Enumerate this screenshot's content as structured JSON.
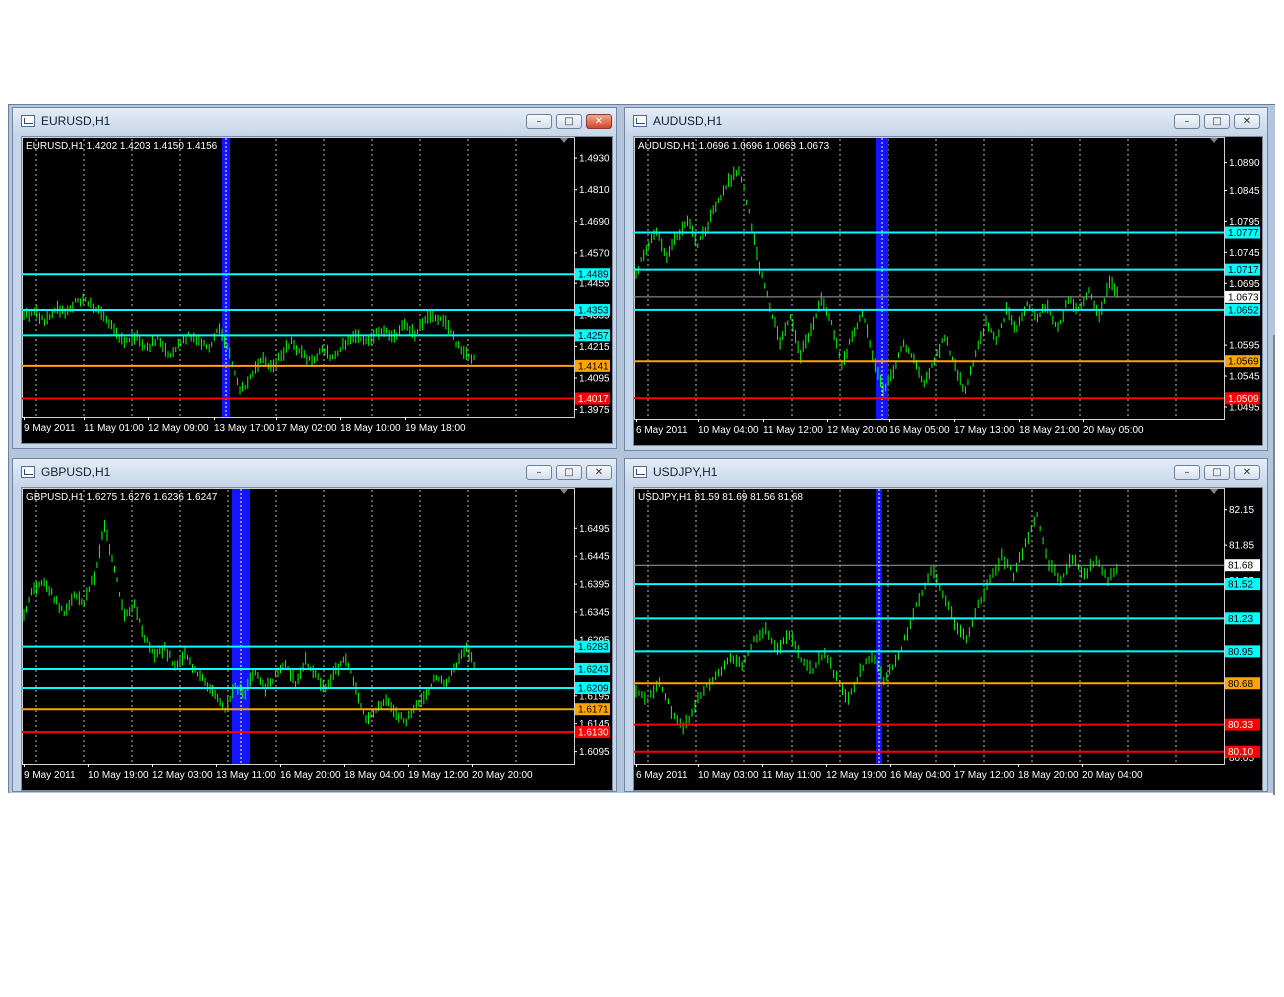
{
  "windows": [
    {
      "title": "EURUSD,H1",
      "info": "EURUSD,H1  1.4202 1.4203 1.4150 1.4156",
      "axis_labels": [
        {
          "text": "1.4930",
          "v": 1.493
        },
        {
          "text": "1.4810",
          "v": 1.481
        },
        {
          "text": "1.4690",
          "v": 1.469
        },
        {
          "text": "1.4570",
          "v": 1.457
        },
        {
          "text": "1.4455",
          "v": 1.4455
        },
        {
          "text": "1.4335",
          "v": 1.4335
        },
        {
          "text": "1.4215",
          "v": 1.4215
        },
        {
          "text": "1.4095",
          "v": 1.4095
        },
        {
          "text": "1.3975",
          "v": 1.3975
        }
      ],
      "levels": [
        {
          "text": "1.4489",
          "v": 1.4489,
          "color": "#00ffff"
        },
        {
          "text": "1.4353",
          "v": 1.4353,
          "color": "#00ffff"
        },
        {
          "text": "1.4257",
          "v": 1.4257,
          "color": "#00ffff"
        },
        {
          "text": "1.4141",
          "v": 1.4141,
          "color": "#ffa500"
        },
        {
          "text": "1.4017",
          "v": 1.4017,
          "color": "#ff0000"
        }
      ],
      "current": null,
      "time_labels": [
        "9 May 2011",
        "11 May 01:00",
        "12 May 09:00",
        "13 May 17:00",
        "17 May 02:00",
        "18 May 10:00",
        "19 May 18:00"
      ],
      "price_path": [
        1.433,
        1.435,
        1.431,
        1.436,
        1.434,
        1.438,
        1.439,
        1.436,
        1.432,
        1.426,
        1.423,
        1.425,
        1.421,
        1.424,
        1.418,
        1.422,
        1.426,
        1.424,
        1.421,
        1.429,
        1.418,
        1.404,
        1.409,
        1.417,
        1.414,
        1.418,
        1.423,
        1.419,
        1.415,
        1.42,
        1.417,
        1.422,
        1.426,
        1.423,
        1.426,
        1.428,
        1.425,
        1.43,
        1.426,
        1.432,
        1.433,
        1.43,
        1.423,
        1.419,
        1.416
      ]
    },
    {
      "title": "AUDUSD,H1",
      "info": "AUDUSD,H1  1.0696 1.0696 1.0663 1.0673",
      "axis_labels": [
        {
          "text": "1.0890",
          "v": 1.089
        },
        {
          "text": "1.0845",
          "v": 1.0845
        },
        {
          "text": "1.0795",
          "v": 1.0795
        },
        {
          "text": "1.0745",
          "v": 1.0745
        },
        {
          "text": "1.0695",
          "v": 1.0695
        },
        {
          "text": "1.0595",
          "v": 1.0595
        },
        {
          "text": "1.0545",
          "v": 1.0545
        },
        {
          "text": "1.0495",
          "v": 1.0495
        }
      ],
      "levels": [
        {
          "text": "1.0777",
          "v": 1.0777,
          "color": "#00ffff"
        },
        {
          "text": "1.0717",
          "v": 1.0717,
          "color": "#00ffff"
        },
        {
          "text": "1.0652",
          "v": 1.0652,
          "color": "#00ffff"
        },
        {
          "text": "1.0569",
          "v": 1.0569,
          "color": "#ffa500"
        },
        {
          "text": "1.0509",
          "v": 1.0509,
          "color": "#ff0000"
        }
      ],
      "current": {
        "text": "1.0673",
        "v": 1.0673
      },
      "time_labels": [
        "6 May 2011",
        "10 May 04:00",
        "11 May 12:00",
        "12 May 20:00",
        "16 May 05:00",
        "17 May 13:00",
        "18 May 21:00",
        "20 May 05:00"
      ],
      "price_path": [
        1.071,
        1.075,
        1.078,
        1.074,
        1.077,
        1.08,
        1.076,
        1.079,
        1.083,
        1.086,
        1.088,
        1.081,
        1.072,
        1.066,
        1.06,
        1.064,
        1.058,
        1.062,
        1.067,
        1.063,
        1.056,
        1.061,
        1.065,
        1.058,
        1.052,
        1.055,
        1.06,
        1.057,
        1.053,
        1.057,
        1.061,
        1.056,
        1.052,
        1.058,
        1.063,
        1.06,
        1.065,
        1.062,
        1.066,
        1.064,
        1.066,
        1.062,
        1.067,
        1.065,
        1.068,
        1.064,
        1.07,
        1.067
      ]
    },
    {
      "title": "GBPUSD,H1",
      "info": "GBPUSD,H1  1.6275 1.6276 1.6236 1.6247",
      "axis_labels": [
        {
          "text": "1.6495",
          "v": 1.6495
        },
        {
          "text": "1.6445",
          "v": 1.6445
        },
        {
          "text": "1.6395",
          "v": 1.6395
        },
        {
          "text": "1.6345",
          "v": 1.6345
        },
        {
          "text": "1.6295",
          "v": 1.6295
        },
        {
          "text": "1.6195",
          "v": 1.6195
        },
        {
          "text": "1.6145",
          "v": 1.6145
        },
        {
          "text": "1.6095",
          "v": 1.6095
        }
      ],
      "levels": [
        {
          "text": "1.6283",
          "v": 1.6283,
          "color": "#00ffff"
        },
        {
          "text": "1.6243",
          "v": 1.6243,
          "color": "#00ffff"
        },
        {
          "text": "1.6209",
          "v": 1.6209,
          "color": "#00ffff"
        },
        {
          "text": "1.6171",
          "v": 1.6171,
          "color": "#ffa500"
        },
        {
          "text": "1.6130",
          "v": 1.613,
          "color": "#ff0000"
        }
      ],
      "current": null,
      "time_labels": [
        "9 May 2011",
        "10 May 19:00",
        "12 May 03:00",
        "13 May 11:00",
        "16 May 20:00",
        "18 May 04:00",
        "19 May 12:00",
        "20 May 20:00"
      ],
      "price_path": [
        1.634,
        1.639,
        1.64,
        1.637,
        1.634,
        1.638,
        1.636,
        1.641,
        1.65,
        1.642,
        1.634,
        1.636,
        1.63,
        1.627,
        1.628,
        1.625,
        1.627,
        1.624,
        1.622,
        1.62,
        1.617,
        1.621,
        1.62,
        1.624,
        1.621,
        1.623,
        1.625,
        1.622,
        1.626,
        1.623,
        1.621,
        1.624,
        1.626,
        1.621,
        1.615,
        1.617,
        1.619,
        1.616,
        1.615,
        1.618,
        1.62,
        1.623,
        1.622,
        1.625,
        1.628,
        1.624
      ]
    },
    {
      "title": "USDJPY,H1",
      "info": "USDJPY,H1  81.59 81.69 81.56 81.68",
      "axis_labels": [
        {
          "text": "82.15",
          "v": 82.15
        },
        {
          "text": "81.85",
          "v": 81.85
        },
        {
          "text": "81.55",
          "v": 81.55
        },
        {
          "text": "80.05",
          "v": 80.05
        }
      ],
      "levels": [
        {
          "text": "81.52",
          "v": 81.52,
          "color": "#00ffff"
        },
        {
          "text": "81.23",
          "v": 81.23,
          "color": "#00ffff"
        },
        {
          "text": "80.95",
          "v": 80.95,
          "color": "#00ffff"
        },
        {
          "text": "80.68",
          "v": 80.68,
          "color": "#ffa500"
        },
        {
          "text": "80.33",
          "v": 80.33,
          "color": "#ff0000"
        },
        {
          "text": "80.10",
          "v": 80.1,
          "color": "#ff0000"
        }
      ],
      "current": {
        "text": "81.68",
        "v": 81.68
      },
      "time_labels": [
        "6 May 2011",
        "10 May 03:00",
        "11 May 11:00",
        "12 May 19:00",
        "16 May 04:00",
        "17 May 12:00",
        "18 May 20:00",
        "20 May 04:00"
      ],
      "price_path": [
        80.62,
        80.55,
        80.7,
        80.45,
        80.28,
        80.5,
        80.65,
        80.75,
        80.9,
        80.82,
        81.05,
        81.15,
        80.95,
        81.1,
        80.88,
        80.8,
        80.95,
        80.72,
        80.55,
        80.78,
        80.92,
        80.7,
        80.88,
        81.1,
        81.4,
        81.65,
        81.45,
        81.2,
        81.05,
        81.35,
        81.55,
        81.75,
        81.6,
        81.85,
        82.1,
        81.7,
        81.55,
        81.75,
        81.6,
        81.72,
        81.55,
        81.68
      ]
    }
  ]
}
